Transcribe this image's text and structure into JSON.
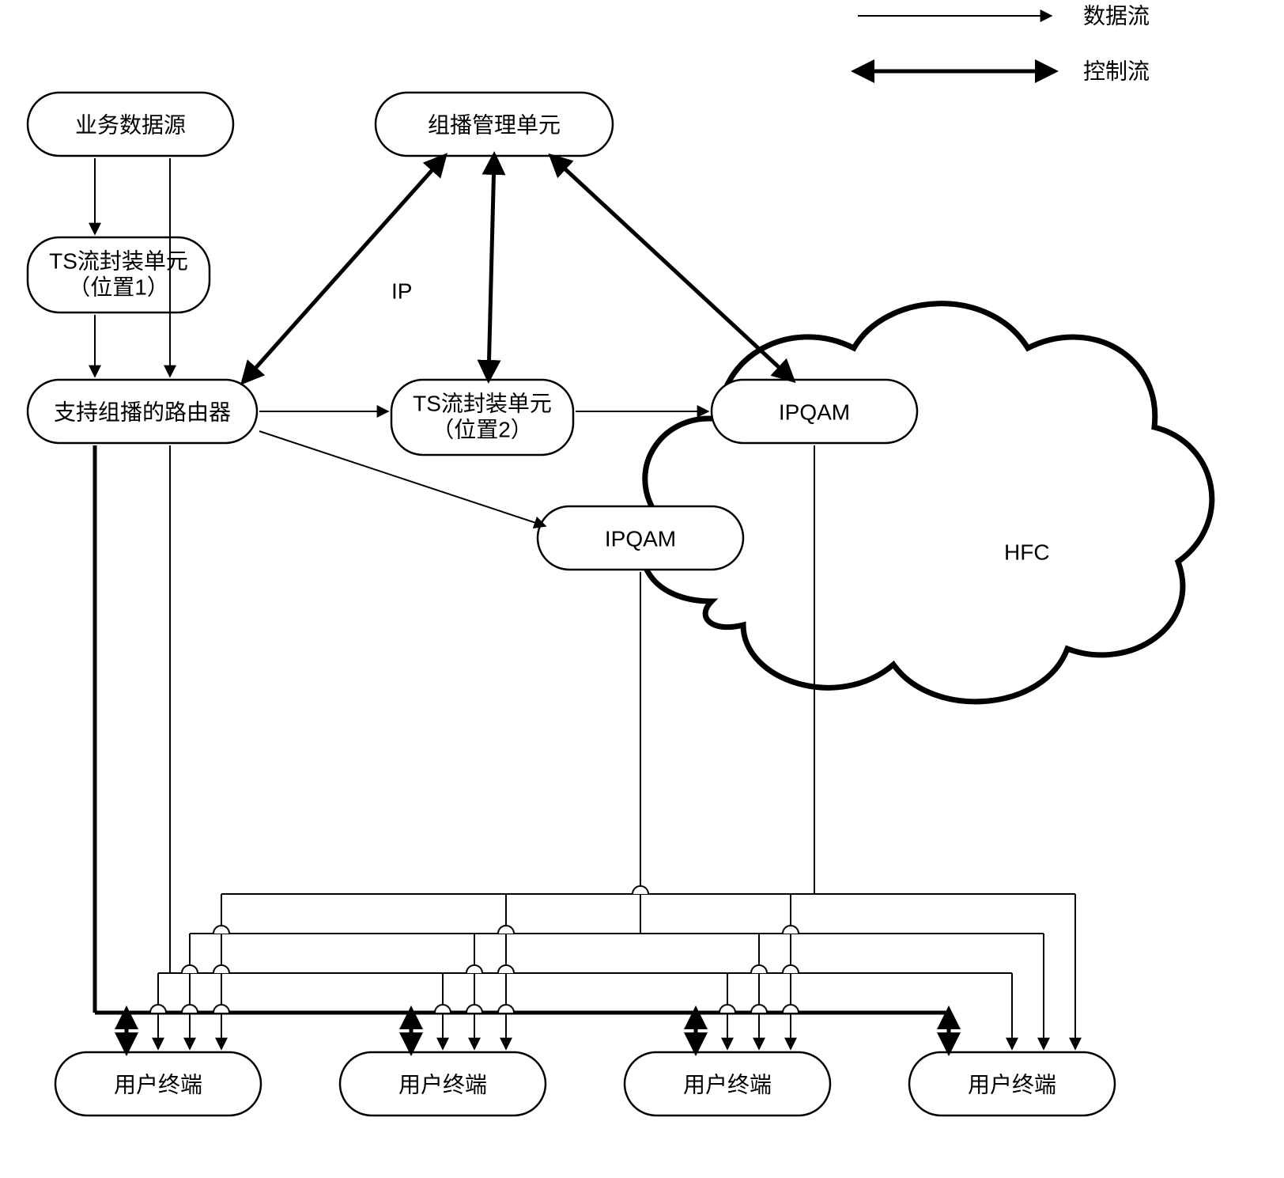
{
  "legend": {
    "data_flow": "数据流",
    "control_flow": "控制流"
  },
  "nodes": {
    "source": "业务数据源",
    "mcast_mgr": "组播管理单元",
    "ts_unit1_line1": "TS流封装单元",
    "ts_unit1_line2": "（位置1）",
    "router": "支持组播的路由器",
    "ts_unit2_line1": "TS流封装单元",
    "ts_unit2_line2": "（位置2）",
    "ipqam1": "IPQAM",
    "ipqam2": "IPQAM",
    "hfc": "HFC",
    "terminal": "用户终端",
    "ip_label": "IP"
  }
}
